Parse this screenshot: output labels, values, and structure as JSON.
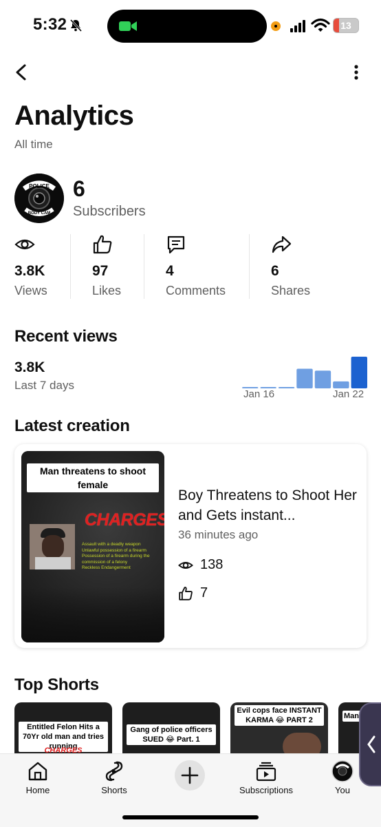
{
  "status": {
    "time": "5:32",
    "battery": "13"
  },
  "page": {
    "title": "Analytics",
    "subtitle": "All time"
  },
  "channel": {
    "avatar_line1": "POLICE",
    "avatar_line2": "BODY CAM",
    "subscribers": "6",
    "subscribers_label": "Subscribers"
  },
  "stats": [
    {
      "icon": "eye-icon",
      "value": "3.8K",
      "label": "Views"
    },
    {
      "icon": "thumbs-up-icon",
      "value": "97",
      "label": "Likes"
    },
    {
      "icon": "comment-icon",
      "value": "4",
      "label": "Comments"
    },
    {
      "icon": "share-icon",
      "value": "6",
      "label": "Shares"
    }
  ],
  "recent_views": {
    "heading": "Recent views",
    "value": "3.8K",
    "period": "Last 7 days",
    "start_label": "Jan 16",
    "end_label": "Jan 22",
    "chart_data": {
      "type": "bar",
      "categories": [
        "Jan 16",
        "Jan 17",
        "Jan 18",
        "Jan 19",
        "Jan 20",
        "Jan 21",
        "Jan 22"
      ],
      "values": [
        0.03,
        0.03,
        0.03,
        0.62,
        0.56,
        0.22,
        1.0
      ]
    }
  },
  "latest": {
    "heading": "Latest creation",
    "thumb_caption": "Man threatens to shoot female",
    "thumb_charges": "CHARGES",
    "thumb_items": [
      "Assault with a deadly weapon",
      "Unlawful possession of a firearm",
      "Possession of a firearm during the commission of a felony",
      "Reckless Endangerment"
    ],
    "title": "Boy Threatens to Shoot Her and Gets instant...",
    "time": "36 minutes ago",
    "views": "138",
    "likes": "7"
  },
  "top_shorts": {
    "heading": "Top Shorts",
    "items": [
      {
        "caption": "Entitled Felon Hits a 70Yr old man and tries running",
        "sub": "CHARGES"
      },
      {
        "caption": "Gang of police officers SUED 😂 Part. 1",
        "sub": ""
      },
      {
        "caption": "Evil cops face INSTANT KARMA 😂 PART 2",
        "sub": ""
      },
      {
        "caption": "Man",
        "sub": ""
      }
    ]
  },
  "nav": {
    "home": "Home",
    "shorts": "Shorts",
    "subscriptions": "Subscriptions",
    "you": "You"
  },
  "colors": {
    "accent_bar": "#1c62d0",
    "bar_light": "#6f9fe2",
    "charges_red": "#e02020"
  }
}
